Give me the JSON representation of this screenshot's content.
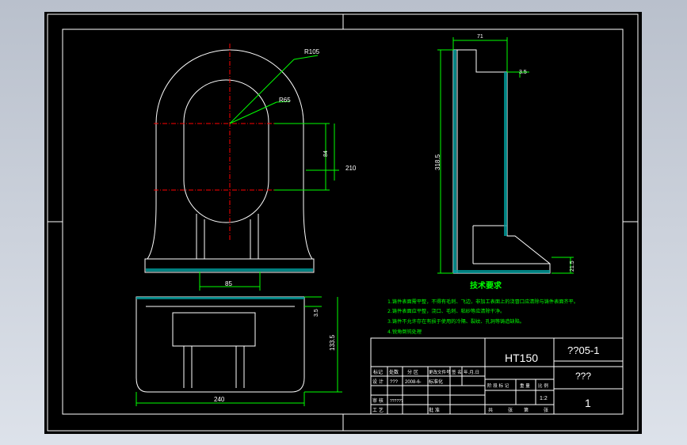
{
  "colors": {
    "background": "#000000",
    "frame": "#ffffff",
    "outline": "#ffffff",
    "centerline": "#ff0000",
    "dimension": "#00ff00",
    "notes": "#00ff00",
    "hatch": "#00c8c8"
  },
  "dimensions": {
    "top_width": "71",
    "radius_outer": "R105",
    "radius_inner": "R65",
    "step": "3.5",
    "height_total": "318.5",
    "center_height": "84",
    "outer_width": "210",
    "base_height": "21.5",
    "inner_width": "85",
    "flange": "3.5",
    "bottom_height": "133.5",
    "bottom_width": "240"
  },
  "notes": {
    "title": "技术要求",
    "items": [
      "1.铸件表面需平整，不得有毛刺、飞边，非加工表面上的浇冒口应清除与铸件表面齐平。",
      "2.铸件表面应平整，浇口、毛刺、粘砂等应清除干净。",
      "3.铸件不允许存在有损于使用的冷隔、裂纹、孔洞等铸造缺陷。",
      "4.锐角倒钝处理"
    ]
  },
  "title_block": {
    "material": "HT150",
    "drawing_no": "??05-1",
    "part_name": "???",
    "sheet_no": "1",
    "scale": "1:2",
    "row_labels": [
      "标记",
      "处数",
      "分 区",
      "更改文件号",
      "签 名",
      "年.月.日"
    ],
    "design_label": "设 计",
    "designer": "???",
    "date": "2008-6-",
    "standardization": "标准化",
    "review_label": "审 核",
    "reviewer": "??????",
    "process_label": "工 艺",
    "approve_label": "批 准",
    "stage_labels": [
      "阶 段 标 记",
      "重 量",
      "比 例"
    ],
    "sheet_text": [
      "共",
      "张",
      "第",
      "张"
    ]
  }
}
